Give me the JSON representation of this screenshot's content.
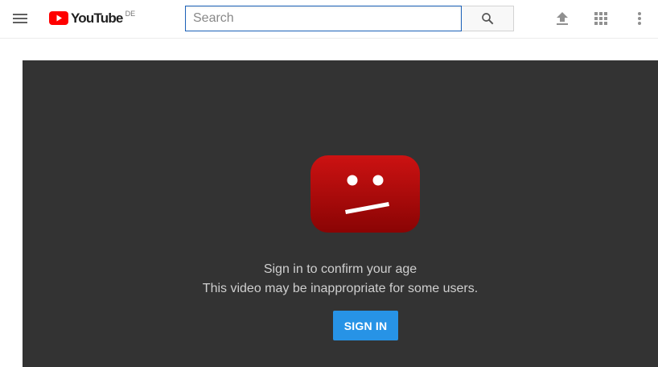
{
  "masthead": {
    "logo_text": "YouTube",
    "country_code": "DE",
    "search_placeholder": "Search",
    "search_value": "",
    "icons": [
      "menu-icon",
      "youtube-logo-icon",
      "search-icon",
      "upload-icon",
      "apps-grid-icon",
      "more-vert-icon"
    ]
  },
  "player": {
    "error_reason": "Sign in to confirm your age",
    "error_subreason": "This video may be inappropriate for some users.",
    "signin_label": "SIGN IN",
    "error_icon": "sad-youtube-play-icon"
  },
  "colors": {
    "brand_red": "#ff0000",
    "player_background": "#333333",
    "signin_button": "#2793e6",
    "search_focus_border": "#1c62b9"
  }
}
